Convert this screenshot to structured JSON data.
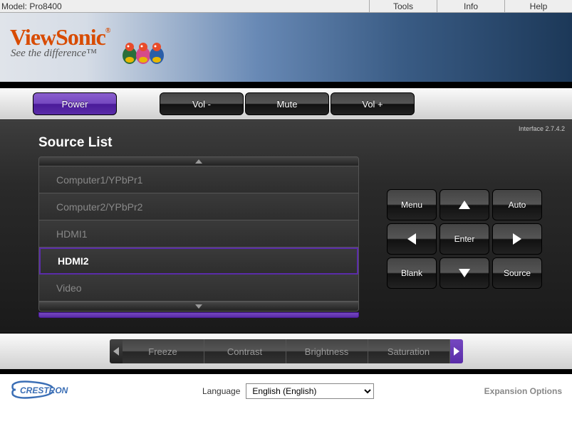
{
  "top": {
    "model_label": "Model: Pro8400",
    "menu": {
      "tools": "Tools",
      "info": "Info",
      "help": "Help"
    }
  },
  "brand": {
    "name": "ViewSonic",
    "reg": "®",
    "tagline": "See the difference™"
  },
  "toolbar": {
    "power": "Power",
    "vol_down": "Vol -",
    "mute": "Mute",
    "vol_up": "Vol +"
  },
  "interface_version": "Interface 2.7.4.2",
  "source": {
    "title": "Source List",
    "items": [
      "Computer1/YPbPr1",
      "Computer2/YPbPr2",
      "HDMI1",
      "HDMI2",
      "Video"
    ],
    "selected_index": 3
  },
  "keypad": {
    "menu": "Menu",
    "auto": "Auto",
    "enter": "Enter",
    "blank": "Blank",
    "source": "Source"
  },
  "tabs": [
    "Freeze",
    "Contrast",
    "Brightness",
    "Saturation"
  ],
  "footer": {
    "crestron": "CRESTRON",
    "language_label": "Language",
    "language_value": "English (English)",
    "expansion": "Expansion Options"
  }
}
